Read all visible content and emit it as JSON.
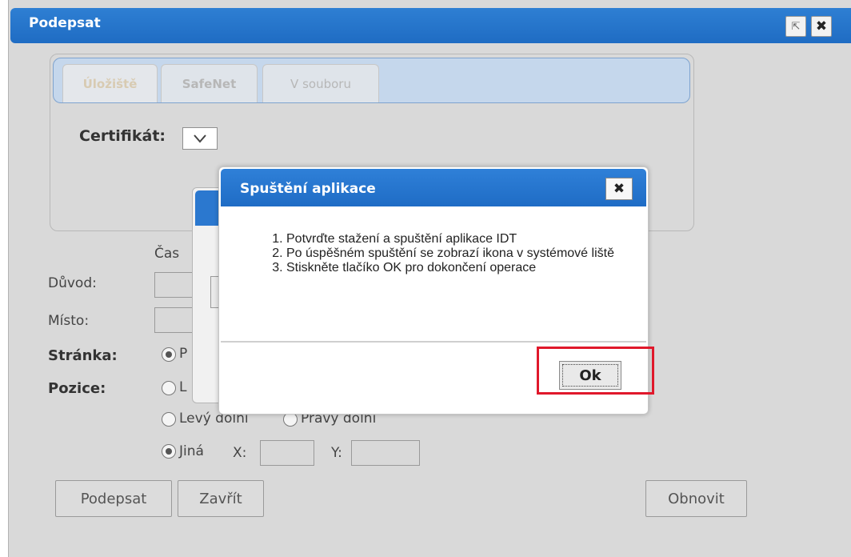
{
  "window": {
    "title": "Podepsat",
    "popout_icon": "popout-icon",
    "close_label": "✖"
  },
  "tabs": [
    {
      "label": "Úložiště"
    },
    {
      "label": "SafeNet"
    },
    {
      "label": "V souboru"
    }
  ],
  "certificate": {
    "label": "Certifikát:",
    "selected": ""
  },
  "form": {
    "time_label": "Čas",
    "reason_label": "Důvod:",
    "place_label": "Místo:",
    "page_label": "Stránka:",
    "position_label": "Pozice:",
    "page_option_partial": "P",
    "position_top_partial": "L",
    "left_bottom": "Levý dolní",
    "right_bottom": "Pravý dolní",
    "other": "Jiná",
    "x_label": "X:",
    "y_label": "Y:"
  },
  "buttons": {
    "sign": "Podepsat",
    "close": "Zavřít",
    "refresh": "Obnovit"
  },
  "launch_dialog": {
    "title": "Spuštění aplikace",
    "close_label": "✖",
    "steps": [
      "Potvrďte stažení a spuštění aplikace IDT",
      "Po úspěšném spuštění se zobrazí ikona v systémové liště",
      "Stiskněte tlačíko OK pro dokončení operace"
    ],
    "ok_label": "Ok"
  },
  "colors": {
    "titlebar": "#2e7fd3",
    "highlight": "#e0182b",
    "background": "#d9d9d9"
  }
}
